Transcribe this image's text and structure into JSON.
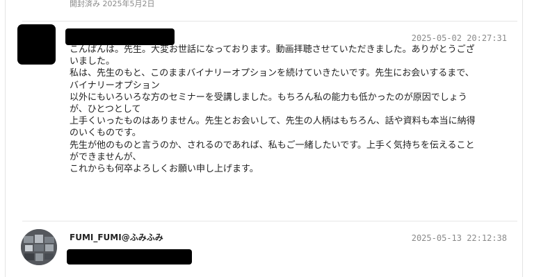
{
  "thread": {
    "read_status": "開封済み 2025年5月2日",
    "messages": [
      {
        "timestamp": "2025-05-02 20:27:31",
        "lines": [
          "こんばんは。先生。大変お世話になっております。動画拝聴させていただきました。ありがとうござ",
          "いました。",
          "私は、先生のもと、このままバイナリーオプションを続けていきたいです。先生にお会いするまで、",
          "バイナリーオプション",
          "以外にもいろいろな方のセミナーを受講しました。もちろん私の能力も低かったのが原因でしょう",
          "が、ひとつとして",
          "上手くいったものはありません。先生とお会いして、先生の人柄はもちろん、話や資料も本当に納得",
          "のいくものです。",
          "先生が他のものと言うのか、されるのであれば、私もご一緒したいです。上手く気持ちを伝えること",
          "ができませんが、",
          "これからも何卒よろしくお願い申し上げます。"
        ]
      },
      {
        "username": "FUMI_FUMI@ふみふみ",
        "timestamp": "2025-05-13 22:12:38"
      }
    ]
  }
}
